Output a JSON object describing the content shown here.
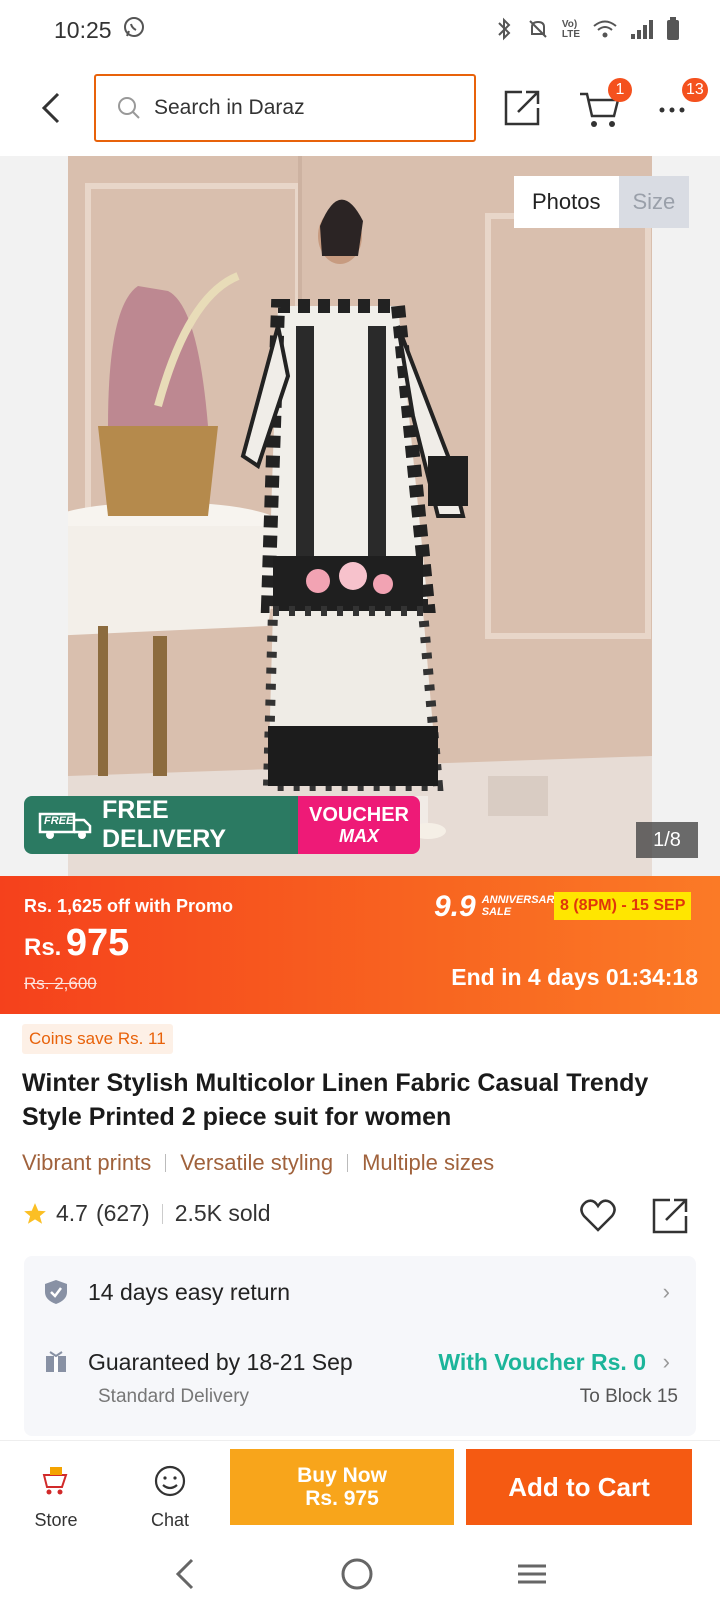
{
  "status_bar": {
    "time": "10:25"
  },
  "header": {
    "search_placeholder": "Search in Daraz",
    "cart_count": "1",
    "more_count": "13"
  },
  "gallery": {
    "tab_photos": "Photos",
    "tab_size": "Size",
    "counter": "1/8",
    "free_delivery_badge": "FREE",
    "free_delivery_label": "FREE DELIVERY",
    "voucher_label": "VOUCHER",
    "voucher_max": "MAX"
  },
  "price": {
    "promo_text": "Rs. 1,625 off with Promo",
    "currency": "Rs.",
    "amount": "975",
    "old_price": "Rs. 2,600",
    "sale_number": "9.9",
    "sale_line1": "ANNIVERSARY",
    "sale_line2": "SALE",
    "sale_dates": "8 (8PM) - 15 SEP",
    "countdown": "End in 4 days 01:34:18"
  },
  "product": {
    "coins": "Coins save Rs. 11",
    "title": "Winter Stylish Multicolor Linen Fabric Casual Trendy Style Printed 2 piece suit for women",
    "features": [
      "Vibrant prints",
      "Versatile styling",
      "Multiple sizes"
    ],
    "rating": "4.7",
    "reviews": "(627)",
    "sold": "2.5K sold"
  },
  "info": {
    "return_text": "14 days easy return",
    "delivery_text": "Guaranteed by 18-21 Sep",
    "voucher_text": "With Voucher Rs. 0",
    "delivery_type": "Standard Delivery",
    "location": "To Block 15"
  },
  "actions": {
    "store": "Store",
    "chat": "Chat",
    "buy_now": "Buy Now",
    "buy_now_price": "Rs. 975",
    "add_to_cart": "Add to Cart"
  },
  "colors": {
    "brand_orange": "#f55a12",
    "buy_now": "#f8a51b",
    "voucher_green": "#1cb59a",
    "free_delivery_green": "#2b7a62",
    "voucher_pink": "#ee1a77"
  }
}
